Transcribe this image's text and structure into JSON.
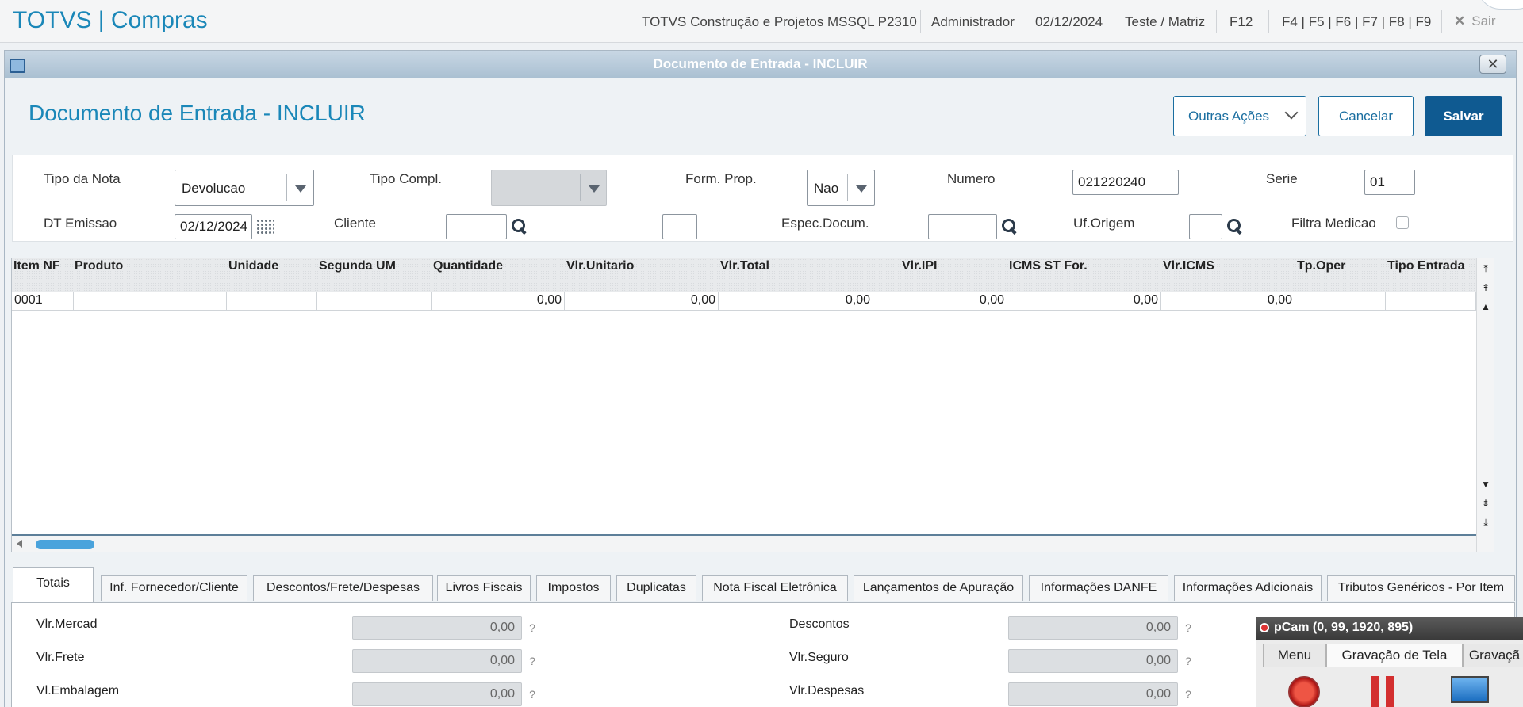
{
  "topbar": {
    "app_title": "TOTVS | Compras",
    "company": "TOTVS Construção e Projetos MSSQL P2310",
    "user": "Administrador",
    "date": "02/12/2024",
    "branch": "Teste / Matriz",
    "f12": "F12",
    "fkeys": "F4 | F5 | F6 | F7 | F8 | F9",
    "exit_label": "Sair"
  },
  "window": {
    "title": "Documento de Entrada - INCLUIR",
    "close_glyph": "✕",
    "heading": "Documento de Entrada - INCLUIR",
    "other_actions_label": "Outras Ações",
    "cancel_label": "Cancelar",
    "save_label": "Salvar"
  },
  "form": {
    "tipo_nota_label": "Tipo da Nota",
    "tipo_nota_value": "Devolucao",
    "tipo_compl_label": "Tipo Compl.",
    "tipo_compl_value": "",
    "form_prop_label": "Form. Prop.",
    "form_prop_value": "Nao",
    "numero_label": "Numero",
    "numero_value": "021220240",
    "serie_label": "Serie",
    "serie_value": "01",
    "dt_emissao_label": "DT Emissao",
    "dt_emissao_value": "02/12/2024",
    "cliente_label": "Cliente",
    "cliente_value": "",
    "loja_value": "",
    "espec_docum_label": "Espec.Docum.",
    "espec_docum_value": "",
    "uf_origem_label": "Uf.Origem",
    "uf_origem_value": "",
    "filtra_medicao_label": "Filtra Medicao"
  },
  "grid": {
    "columns": [
      "Item NF",
      "Produto",
      "Unidade",
      "Segunda UM",
      "Quantidade",
      "Vlr.Unitario",
      "Vlr.Total",
      "Vlr.IPI",
      "ICMS ST For.",
      "Vlr.ICMS",
      "Tp.Oper",
      "Tipo Entrada"
    ],
    "rows": [
      {
        "item": "0001",
        "produto": "",
        "unidade": "",
        "segunda_um": "",
        "quantidade": "0,00",
        "vlr_unitario": "0,00",
        "vlr_total": "0,00",
        "vlr_ipi": "0,00",
        "icms_st": "0,00",
        "vlr_icms": "0,00",
        "tp_oper": "",
        "tipo_entrada": ""
      }
    ]
  },
  "tabs": [
    "Totais",
    "Inf. Fornecedor/Cliente",
    "Descontos/Frete/Despesas",
    "Livros Fiscais",
    "Impostos",
    "Duplicatas",
    "Nota Fiscal Eletrônica",
    "Lançamentos de Apuração",
    "Informações DANFE",
    "Informações Adicionais",
    "Tributos Genéricos - Por Item"
  ],
  "totais": {
    "vlr_mercad_label": "Vlr.Mercad",
    "vlr_mercad_value": "0,00",
    "vlr_frete_label": "Vlr.Frete",
    "vlr_frete_value": "0,00",
    "vl_embalagem_label": "Vl.Embalagem",
    "vl_embalagem_value": "0,00",
    "descontos_label": "Descontos",
    "descontos_value": "0,00",
    "vlr_seguro_label": "Vlr.Seguro",
    "vlr_seguro_value": "0,00",
    "vlr_despesas_label": "Vlr.Despesas",
    "vlr_despesas_value": "0,00",
    "help_glyph": "?"
  },
  "recorder": {
    "title": "pCam (0, 99, 1920, 895)",
    "menu_tab": "Menu",
    "screen_tab": "Gravação de Tela",
    "other_tab": "Gravaçã"
  }
}
